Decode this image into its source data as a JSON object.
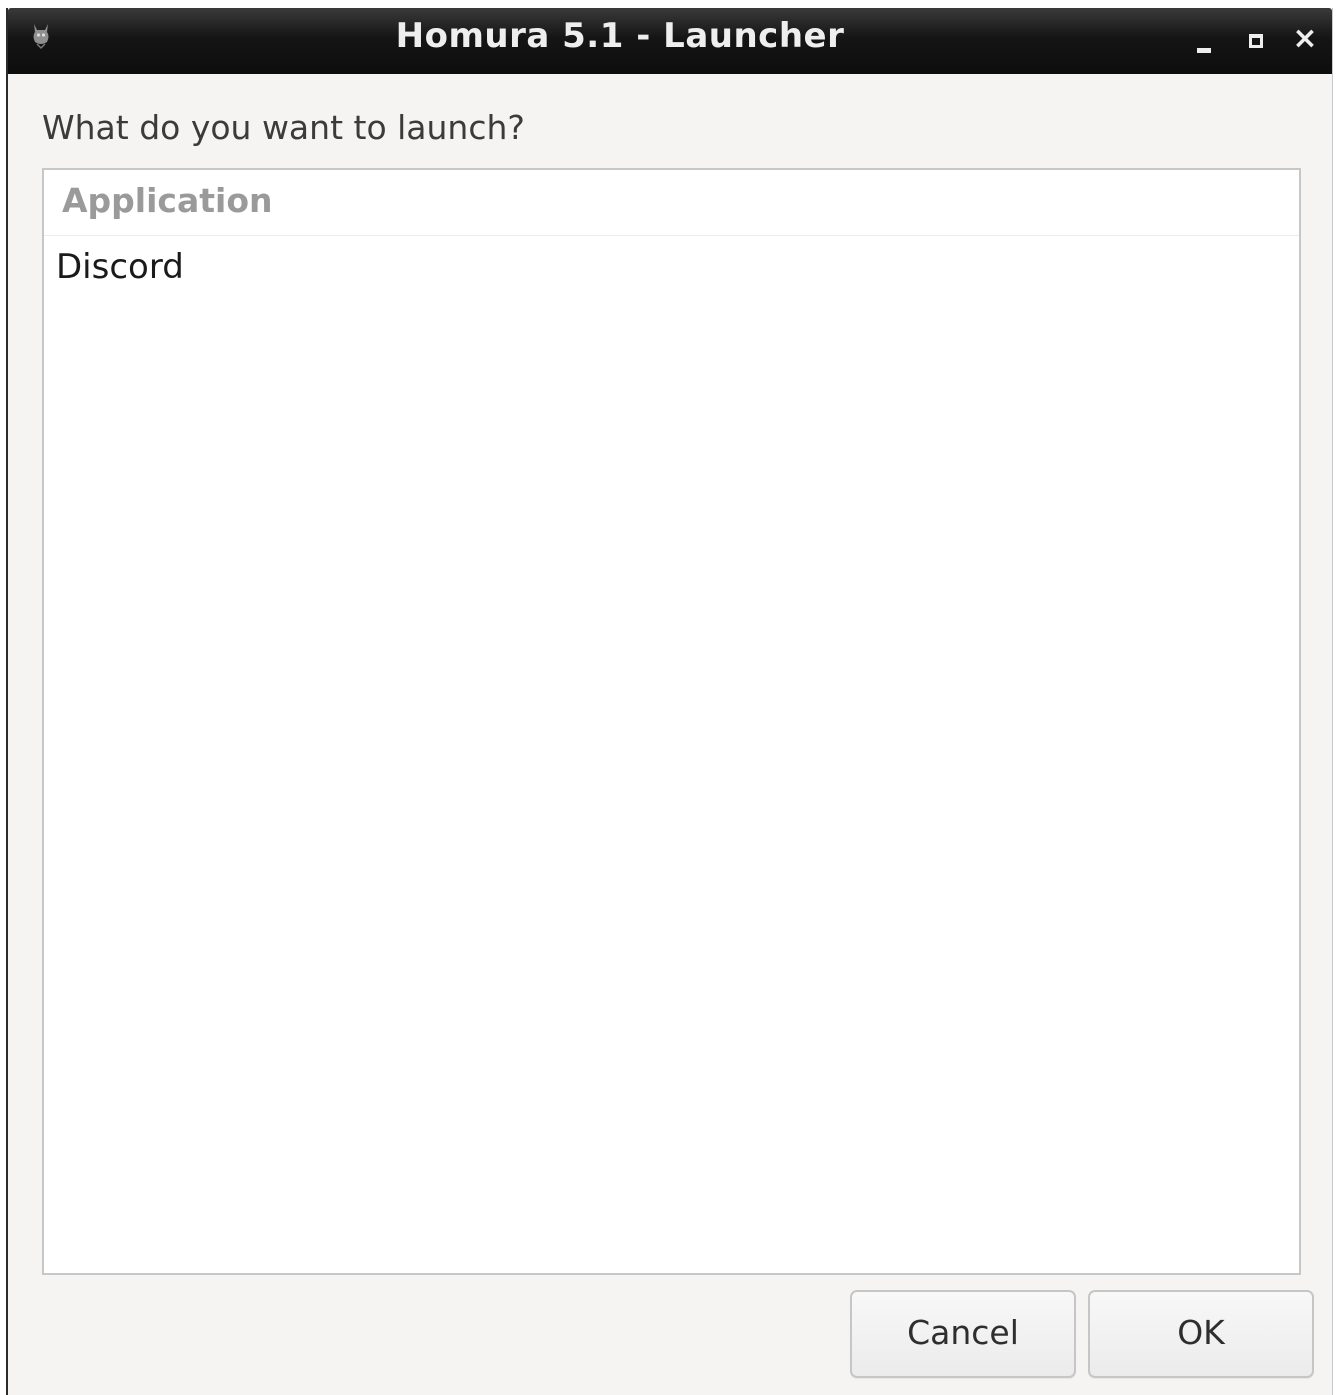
{
  "window": {
    "title": "Homura 5.1 - Launcher",
    "icon": "homura-cat-icon"
  },
  "window_controls": {
    "minimize": "minimize-icon",
    "maximize": "maximize-icon",
    "close": "close-icon",
    "close_glyph": "×"
  },
  "prompt": "What do you want to launch?",
  "list": {
    "header": "Application",
    "items": [
      {
        "label": "Discord"
      }
    ]
  },
  "buttons": {
    "cancel_label": "Cancel",
    "ok_label": "OK"
  },
  "colors": {
    "titlebar": "#151515",
    "title_text": "#eeeeee",
    "window_bg": "#f5f4f3",
    "list_bg": "#ffffff",
    "header_text": "#9a9a9a"
  }
}
